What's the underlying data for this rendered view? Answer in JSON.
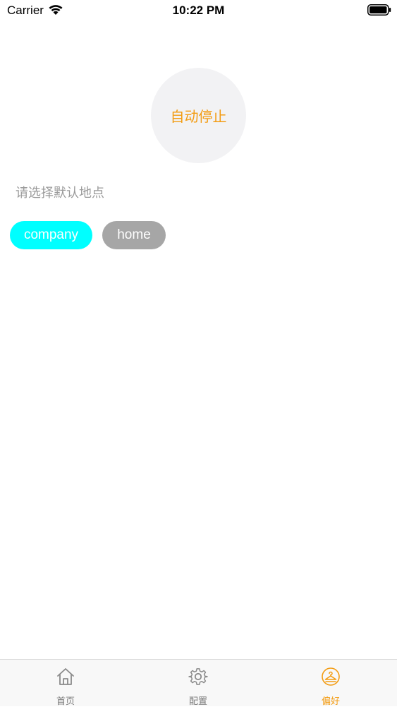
{
  "status_bar": {
    "carrier": "Carrier",
    "time": "10:22 PM"
  },
  "auto_stop": {
    "label": "自动停止"
  },
  "location": {
    "prompt": "请选择默认地点",
    "options": [
      {
        "label": "company",
        "selected": true,
        "color": "#00ffff"
      },
      {
        "label": "home",
        "selected": false,
        "color": "#a6a6a6"
      }
    ]
  },
  "tab_bar": {
    "tabs": [
      {
        "label": "首页",
        "icon": "house-icon",
        "active": false
      },
      {
        "label": "配置",
        "icon": "gear-icon",
        "active": false
      },
      {
        "label": "偏好",
        "icon": "hanger-icon",
        "active": true
      }
    ],
    "active_color": "#f39c12",
    "inactive_color": "#7a7a7a"
  }
}
